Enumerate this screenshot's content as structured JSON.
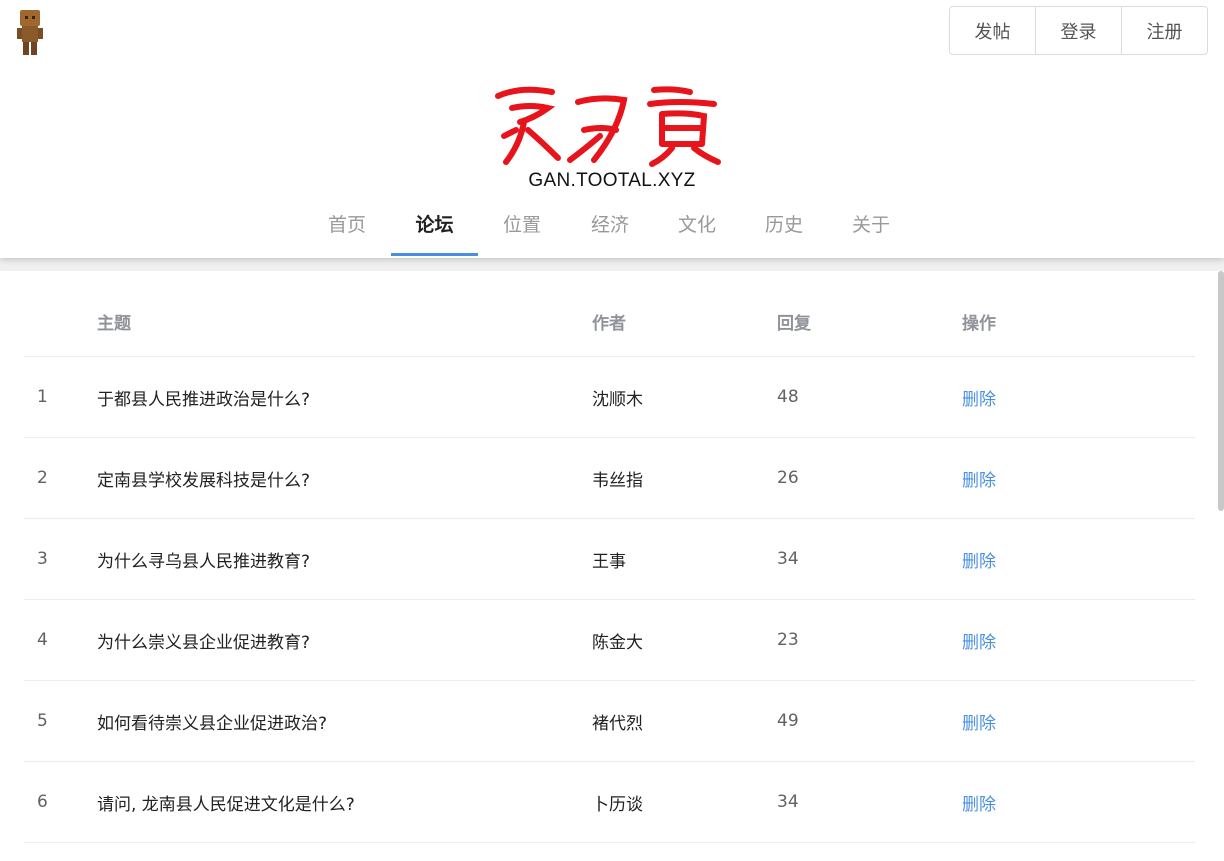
{
  "header": {
    "logo_text": "赣力贡",
    "domain": "GAN.TOOTAL.XYZ",
    "auth": {
      "post": "发帖",
      "login": "登录",
      "register": "注册"
    }
  },
  "nav": {
    "items": [
      "首页",
      "论坛",
      "位置",
      "经济",
      "文化",
      "历史",
      "关于"
    ],
    "active": "论坛"
  },
  "table": {
    "headers": {
      "topic": "主题",
      "author": "作者",
      "replies": "回复",
      "action": "操作"
    },
    "rows": [
      {
        "index": "1",
        "topic": "于都县人民推进政治是什么?",
        "author": "沈顺木",
        "replies": "48",
        "action": "删除"
      },
      {
        "index": "2",
        "topic": "定南县学校发展科技是什么?",
        "author": "韦丝指",
        "replies": "26",
        "action": "删除"
      },
      {
        "index": "3",
        "topic": "为什么寻乌县人民推进教育?",
        "author": "王事",
        "replies": "34",
        "action": "删除"
      },
      {
        "index": "4",
        "topic": "为什么崇义县企业促进教育?",
        "author": "陈金大",
        "replies": "23",
        "action": "删除"
      },
      {
        "index": "5",
        "topic": "如何看待崇义县企业促进政治?",
        "author": "褚代烈",
        "replies": "49",
        "action": "删除"
      },
      {
        "index": "6",
        "topic": "请问, 龙南县人民促进文化是什么?",
        "author": "卜历谈",
        "replies": "34",
        "action": "删除"
      }
    ]
  },
  "colors": {
    "accent": "#4a90e2",
    "logo_red": "#e8141b"
  }
}
